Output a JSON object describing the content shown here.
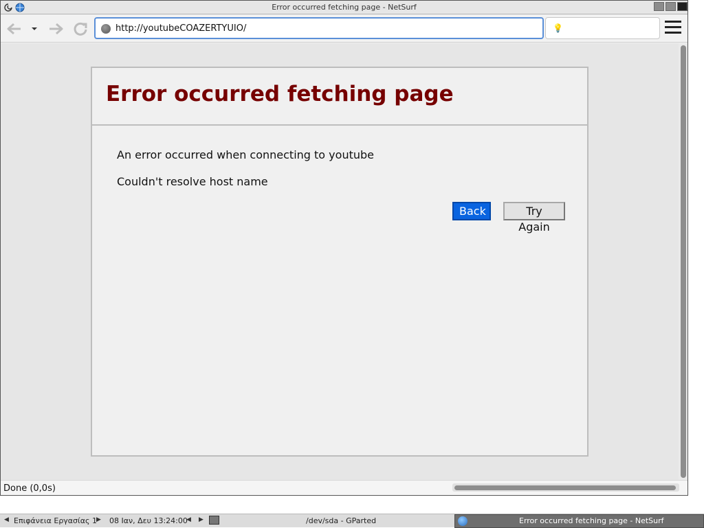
{
  "window": {
    "title": "Error occurred fetching page - NetSurf"
  },
  "toolbar": {
    "back_icon": "back-arrow-icon",
    "history_icon": "dropdown-arrow-icon",
    "forward_icon": "forward-arrow-icon",
    "reload_icon": "reload-icon",
    "url": "http://youtubeCOAZERTYUIO/",
    "search_placeholder": "",
    "menu_icon": "hamburger-menu-icon"
  },
  "page": {
    "heading": "Error occurred fetching page",
    "message": "An error occurred when connecting to youtube",
    "detail": "Couldn't resolve host name",
    "back_label": "Back",
    "try_again_label": "Try Again"
  },
  "statusbar": {
    "status": "Done (0,0s)"
  },
  "taskbar": {
    "desktop_label": "Επιφάνεια Εργασίας 1",
    "clock": "08 Ιαν, Δευ 13:24:00",
    "task_gparted": "/dev/sda - GParted",
    "task_netsurf": "Error occurred fetching page - NetSurf"
  },
  "colors": {
    "heading": "#760000",
    "primary_button": "#0a64e0",
    "url_focus_border": "#5a8fd8"
  }
}
